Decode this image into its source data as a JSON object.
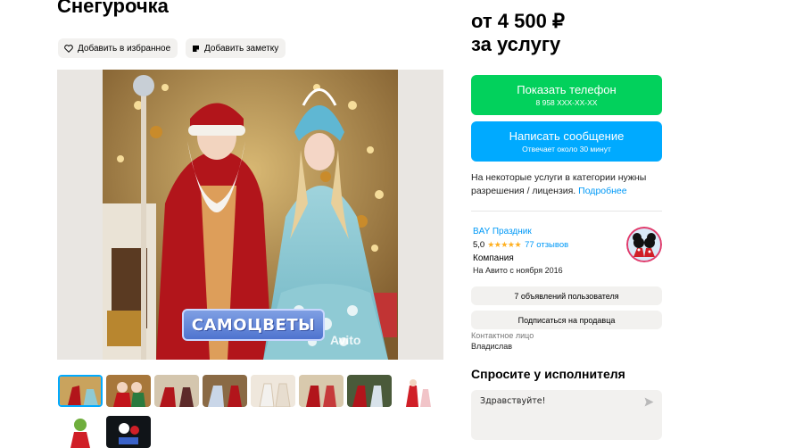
{
  "listing": {
    "title": "Снегурочка",
    "favorite_label": "Добавить в избранное",
    "note_label": "Добавить заметку",
    "photo_watermark": "САМОЦВЕТЫ",
    "photo_brand_mark": "Avito",
    "thumbnails": [
      {
        "icon": "photo-thumb-1",
        "active": true
      },
      {
        "icon": "photo-thumb-2"
      },
      {
        "icon": "photo-thumb-3"
      },
      {
        "icon": "photo-thumb-4"
      },
      {
        "icon": "photo-thumb-5"
      },
      {
        "icon": "photo-thumb-6"
      },
      {
        "icon": "photo-thumb-7"
      },
      {
        "icon": "photo-thumb-8"
      },
      {
        "icon": "photo-thumb-9"
      },
      {
        "icon": "photo-thumb-10"
      }
    ]
  },
  "sidebar": {
    "price_line1": "от 4 500 ₽",
    "price_line2": "за услугу",
    "phone_button": {
      "label": "Показать телефон",
      "sub": "8 958 XXX-XX-XX",
      "color": "#02d15c"
    },
    "message_button": {
      "label": "Написать сообщение",
      "sub": "Отвечает около 30 минут",
      "color": "#00aaff"
    },
    "license_text": "На некоторые услуги в категории нужны разрешения / лицензия.",
    "license_link": "Подробнее",
    "seller": {
      "name": "BAY Праздник",
      "rating": "5,0",
      "stars": "★★★★★",
      "reviews": "77 отзывов",
      "type": "Компания",
      "since": "На Авито с ноября 2016"
    },
    "listings_button": "7 объявлений пользователя",
    "subscribe_button": "Подписаться на продавца",
    "contact_label": "Контактное лицо",
    "contact_name": "Владислав",
    "ask_title": "Спросите у исполнителя",
    "ask_input_value": "Здравствуйте!"
  },
  "colors": {
    "link": "#0099f7",
    "accent_green": "#02d15c",
    "accent_blue": "#00aaff",
    "star": "#ffb021"
  }
}
